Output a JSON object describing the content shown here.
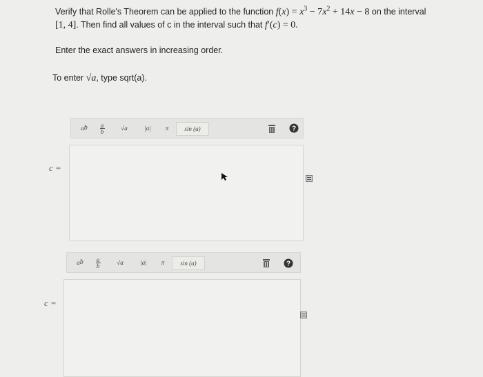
{
  "question": {
    "line1_prefix": "Verify that Rolle's Theorem can be applied to the function ",
    "function": "f(x) = x³ − 7x² + 14x − 8",
    "line1_suffix": " on the interval",
    "interval": "[1, 4]",
    "line2_text": ". Then find all values of c in the interval such that ",
    "condition": "f′(c) = 0."
  },
  "instructions": {
    "order_note": "Enter the exact answers in increasing order.",
    "sqrt_prefix": "To enter ",
    "sqrt_symbol": "√a",
    "sqrt_suffix": ", type sqrt(a)."
  },
  "toolbar": {
    "power": "aᵇ",
    "fraction_top": "a",
    "fraction_bottom": "b",
    "sqrt": "√a",
    "abs": "|a|",
    "pi": "π",
    "sin": "sin (a)"
  },
  "answers": [
    {
      "label": "c =",
      "value": ""
    },
    {
      "label": "c =",
      "value": ""
    }
  ],
  "icons": {
    "trash": "trash-icon",
    "help": "help-icon",
    "side": "equation-editor-icon",
    "cursor": "mouse-cursor-icon"
  }
}
